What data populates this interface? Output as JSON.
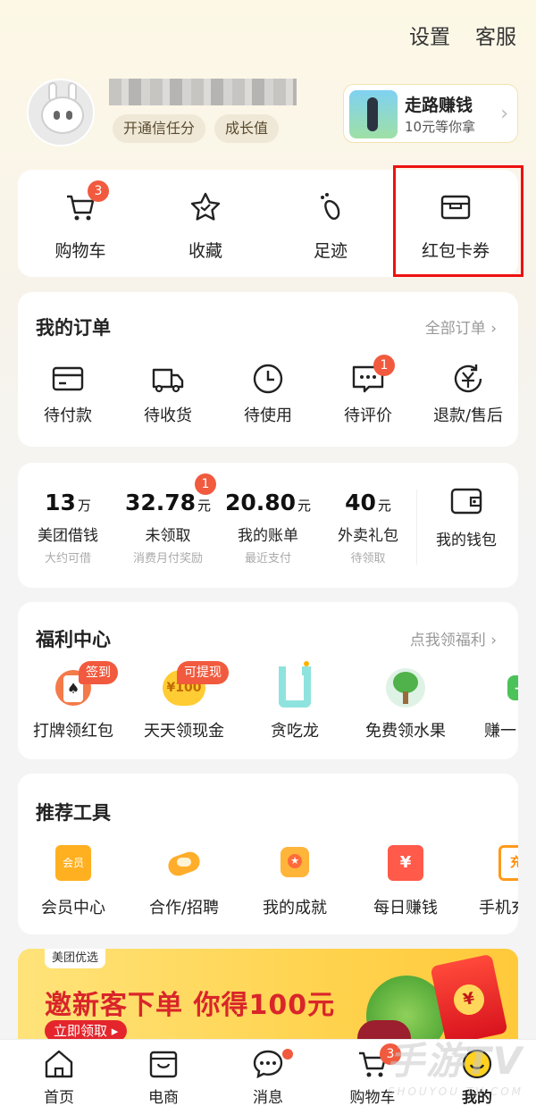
{
  "header": {
    "settings_label": "设置",
    "service_label": "客服"
  },
  "profile": {
    "tags": [
      "开通信任分",
      "成长值"
    ],
    "promo": {
      "title": "走路赚钱",
      "subtitle": "10元等你拿"
    }
  },
  "quick_actions": [
    {
      "label": "购物车",
      "badge": "3",
      "icon": "cart-icon"
    },
    {
      "label": "收藏",
      "icon": "star-icon"
    },
    {
      "label": "足迹",
      "icon": "footprint-icon"
    },
    {
      "label": "红包卡券",
      "icon": "wallet-card-icon",
      "highlighted": true
    }
  ],
  "orders": {
    "title": "我的订单",
    "all_link": "全部订单",
    "items": [
      {
        "label": "待付款",
        "icon": "card-icon"
      },
      {
        "label": "待收货",
        "icon": "truck-icon"
      },
      {
        "label": "待使用",
        "icon": "clock-icon"
      },
      {
        "label": "待评价",
        "icon": "comment-icon",
        "badge": "1"
      },
      {
        "label": "退款/售后",
        "icon": "refund-icon"
      }
    ]
  },
  "wallet": {
    "items": [
      {
        "value": "13",
        "unit": "万",
        "label": "美团借钱",
        "sub": "大约可借"
      },
      {
        "value": "32.78",
        "unit": "元",
        "label": "未领取",
        "sub": "消费月付奖励",
        "badge": "1"
      },
      {
        "value": "20.80",
        "unit": "元",
        "label": "我的账单",
        "sub": "最近支付"
      },
      {
        "value": "40",
        "unit": "元",
        "label": "外卖礼包",
        "sub": "待领取"
      }
    ],
    "my_wallet_label": "我的钱包"
  },
  "welfare": {
    "title": "福利中心",
    "link": "点我领福利",
    "items": [
      {
        "label": "打牌领红包",
        "tag": "签到",
        "icon": "poker-icon"
      },
      {
        "label": "天天领现金",
        "tag": "可提现",
        "icon": "coin-icon",
        "icon_text": "¥100"
      },
      {
        "label": "贪吃龙",
        "icon": "snake-icon"
      },
      {
        "label": "免费领水果",
        "icon": "tree-icon"
      },
      {
        "label": "赚一",
        "icon": "plus-game-icon"
      }
    ]
  },
  "tools": {
    "title": "推荐工具",
    "items": [
      {
        "label": "会员中心",
        "icon": "member-icon",
        "icon_text": "会员"
      },
      {
        "label": "合作/招聘",
        "icon": "handshake-icon"
      },
      {
        "label": "我的成就",
        "icon": "medal-icon"
      },
      {
        "label": "每日赚钱",
        "icon": "calendar-money-icon",
        "icon_text": "¥"
      },
      {
        "label": "手机充",
        "icon": "phone-charge-icon",
        "icon_text": "充"
      }
    ]
  },
  "banner": {
    "brand": "美团优选",
    "headline": "邀新客下单 你得100元",
    "cta": "立即领取 ▸",
    "envelope_text": "¥"
  },
  "tabbar": [
    {
      "label": "首页",
      "icon": "home-icon"
    },
    {
      "label": "电商",
      "icon": "shop-bag-icon"
    },
    {
      "label": "消息",
      "icon": "message-icon",
      "dot": true
    },
    {
      "label": "购物车",
      "icon": "cart-icon",
      "badge": "3"
    },
    {
      "label": "我的",
      "icon": "profile-smile-icon",
      "active": true
    }
  ],
  "watermark": {
    "main": "手游TV",
    "sub": "SHOUYOU TV.COM"
  },
  "colors": {
    "accent": "#f15a3e",
    "highlight_box": "#e11111",
    "banner_red": "#d9252a"
  }
}
